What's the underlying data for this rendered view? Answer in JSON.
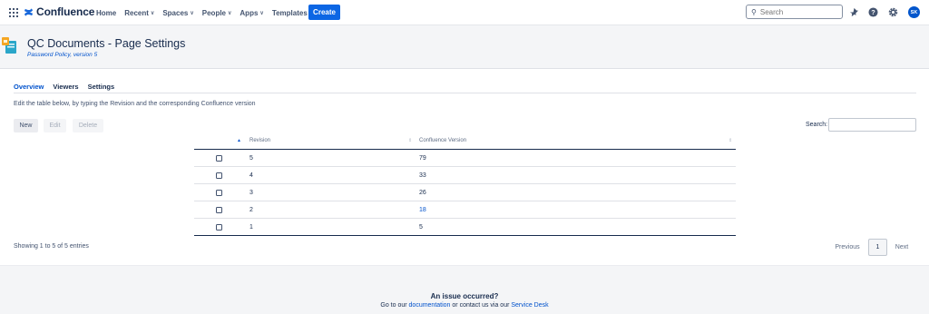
{
  "nav": {
    "logo_text": "Confluence",
    "items": [
      {
        "label": "Home",
        "dropdown": false
      },
      {
        "label": "Recent",
        "dropdown": true
      },
      {
        "label": "Spaces",
        "dropdown": true
      },
      {
        "label": "People",
        "dropdown": true
      },
      {
        "label": "Apps",
        "dropdown": true
      },
      {
        "label": "Templates",
        "dropdown": false
      }
    ],
    "create_label": "Create",
    "search_placeholder": "Search",
    "avatar_initials": "SK",
    "accent": "#0c66e4"
  },
  "page": {
    "title": "QC Documents - Page Settings",
    "subtitle": "Password Policy, version 5"
  },
  "tabs": [
    {
      "label": "Overview",
      "active": true
    },
    {
      "label": "Viewers",
      "active": false
    },
    {
      "label": "Settings",
      "active": false
    }
  ],
  "description": "Edit the table below, by typing the Revision and the corresponding Confluence version",
  "toolbar": {
    "new_label": "New",
    "edit_label": "Edit",
    "delete_label": "Delete",
    "search_label": "Search:"
  },
  "table": {
    "columns": [
      "Revision",
      "Confluence Version"
    ],
    "rows": [
      {
        "revision": "5",
        "version": "79",
        "link": false
      },
      {
        "revision": "4",
        "version": "33",
        "link": false
      },
      {
        "revision": "3",
        "version": "26",
        "link": false
      },
      {
        "revision": "2",
        "version": "18",
        "link": true
      },
      {
        "revision": "1",
        "version": "5",
        "link": false
      }
    ]
  },
  "pagination": {
    "info": "Showing 1 to 5 of 5 entries",
    "previous": "Previous",
    "current": "1",
    "next": "Next"
  },
  "footer": {
    "title": "An issue occurred?",
    "text_before": "Go to our ",
    "doc_link": "documentation",
    "text_middle": " or contact us via our ",
    "desk_link": "Service Desk"
  }
}
